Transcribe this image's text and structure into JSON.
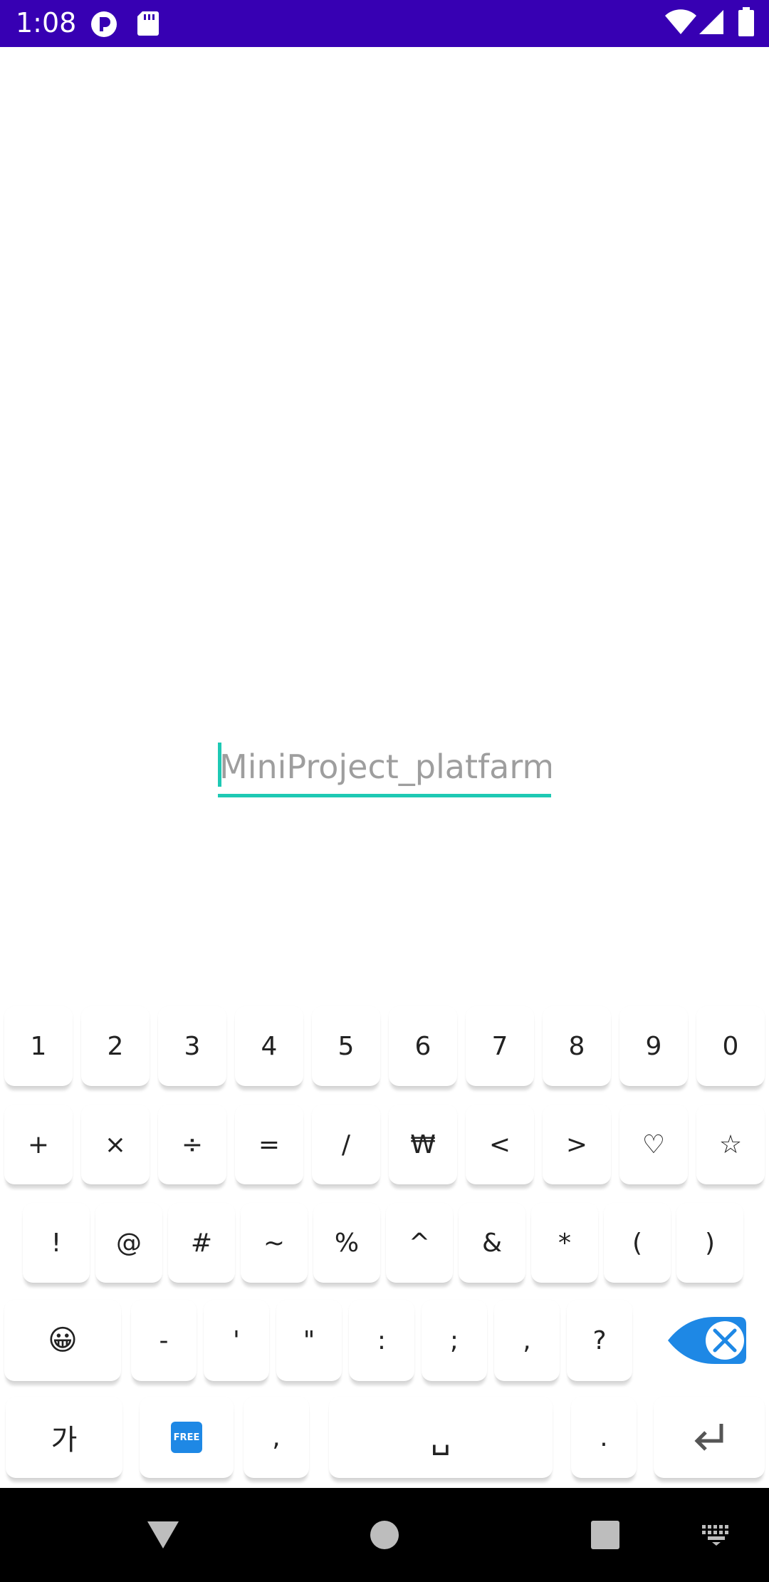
{
  "status_bar": {
    "time": "1:08",
    "icons": [
      "app-notification-icon",
      "sd-card-icon",
      "wifi-icon",
      "cell-signal-icon",
      "battery-icon"
    ]
  },
  "text_field": {
    "placeholder": "MiniProject_platfarm",
    "value": "",
    "accent_color": "#1ec9b4"
  },
  "keyboard": {
    "row1": [
      "1",
      "2",
      "3",
      "4",
      "5",
      "6",
      "7",
      "8",
      "9",
      "0"
    ],
    "row2": [
      "+",
      "×",
      "÷",
      "=",
      "/",
      "₩",
      "<",
      ">",
      "♡",
      "☆"
    ],
    "row3": [
      "!",
      "@",
      "#",
      "~",
      "%",
      "^",
      "&",
      "*",
      "(",
      ")"
    ],
    "row4": [
      "-",
      "'",
      "\"",
      ":",
      ";",
      ",",
      "?"
    ],
    "row4_emoji": "😀",
    "bottom": {
      "lang_label": "가",
      "free_label": "FREE",
      "comma_label": ",",
      "space_label": "␣",
      "period_label": "."
    },
    "accent_color": "#1e88e5"
  },
  "nav_bar": {
    "buttons": [
      "back-icon",
      "home-icon",
      "recents-icon",
      "keyboard-switch-icon"
    ]
  }
}
